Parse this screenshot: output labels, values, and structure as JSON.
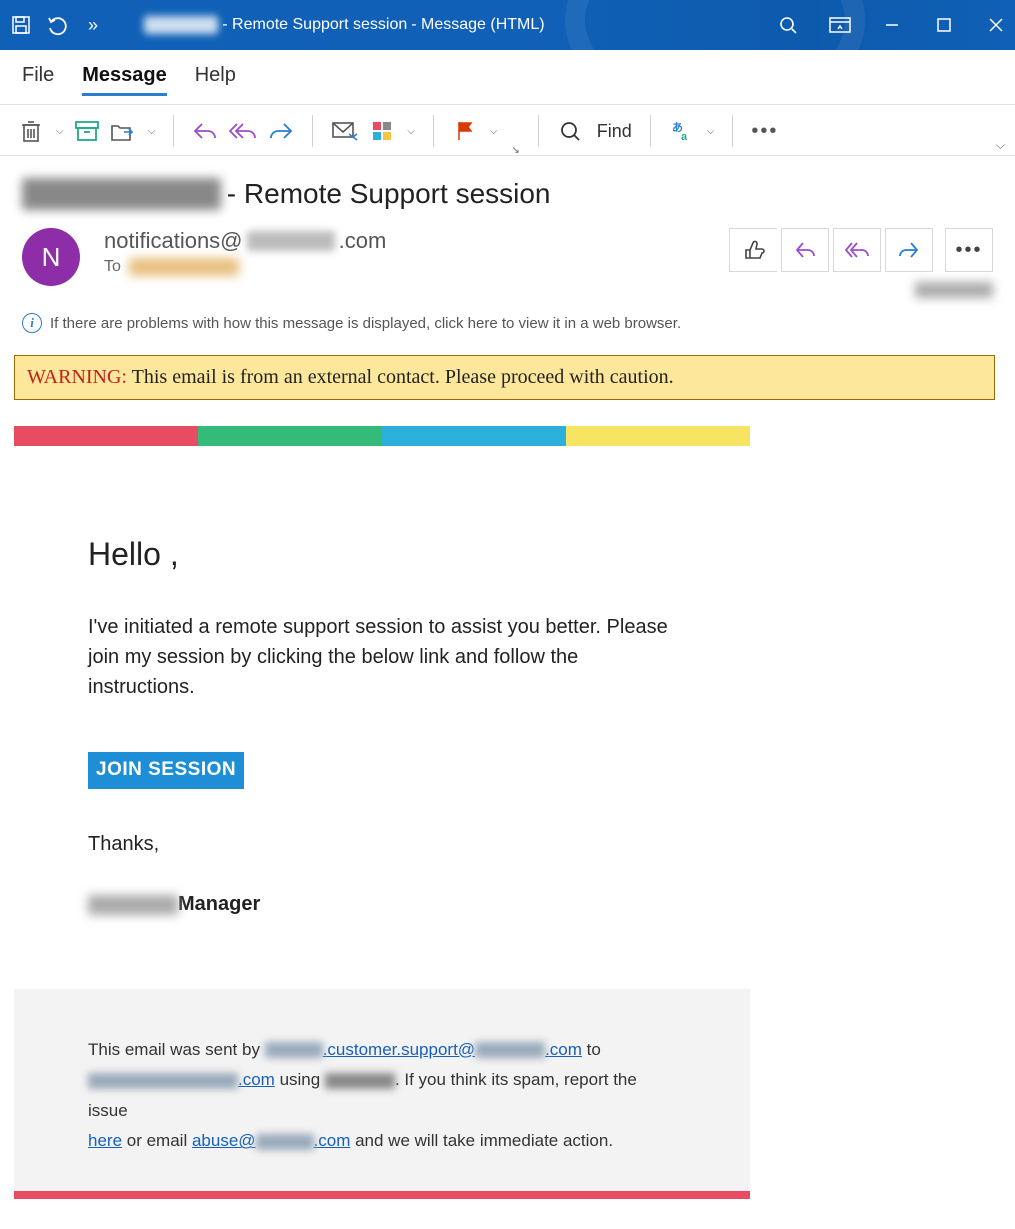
{
  "titlebar": {
    "subject_redacted": "redacted",
    "subject_suffix": " - Remote Support session",
    "context": "  -  Message (HTML)",
    "overflow_glyph": "»"
  },
  "tabs": {
    "file": "File",
    "message": "Message",
    "help": "Help"
  },
  "ribbon": {
    "find": "Find",
    "more_glyph": "•••",
    "caret_glyph": "⌵",
    "overflow_caret": "⌵",
    "dialog_launcher": "↘"
  },
  "subject": {
    "redacted_prefix": "redacted name",
    "suffix": " - Remote Support session"
  },
  "sender": {
    "avatar_initial": "N",
    "from_prefix": "notifications@",
    "from_redacted": "domain",
    "from_suffix": ".com",
    "to_label": "To",
    "to_redacted": "recipient"
  },
  "infobar": {
    "text": "If there are problems with how this message is displayed, click here to view it in a web browser.",
    "icon_glyph": "i"
  },
  "warning": {
    "label": "WARNING:",
    "text": " This email is from an external contact. Please proceed with caution."
  },
  "body": {
    "greeting": "Hello ,",
    "paragraph": "I've initiated a remote support session to assist you better. Please join my session by clicking the below link and follow the instructions.",
    "join_button": "JOIN SESSION",
    "thanks": "Thanks,",
    "role_suffix": "Manager"
  },
  "footer": {
    "pre1": "This email was sent by ",
    "link1_mid": ".customer.support@",
    "link1_suffix": ".com",
    "post1": " to",
    "link2_suffix": ".com",
    "post2": " using ",
    "post2b": ". If you think its spam, report the issue ",
    "here": "here",
    "post3": " or email ",
    "abuse_prefix": "abuse@",
    "abuse_suffix": ".com",
    "post4": " and we will take immediate action."
  },
  "colors": {
    "stripe": [
      "#e84c62",
      "#34bb7a",
      "#2bb0d9",
      "#f7e463"
    ],
    "primary": "#1e8fd6",
    "titlebar": "#0f60b6",
    "avatar": "#8e2da8"
  }
}
